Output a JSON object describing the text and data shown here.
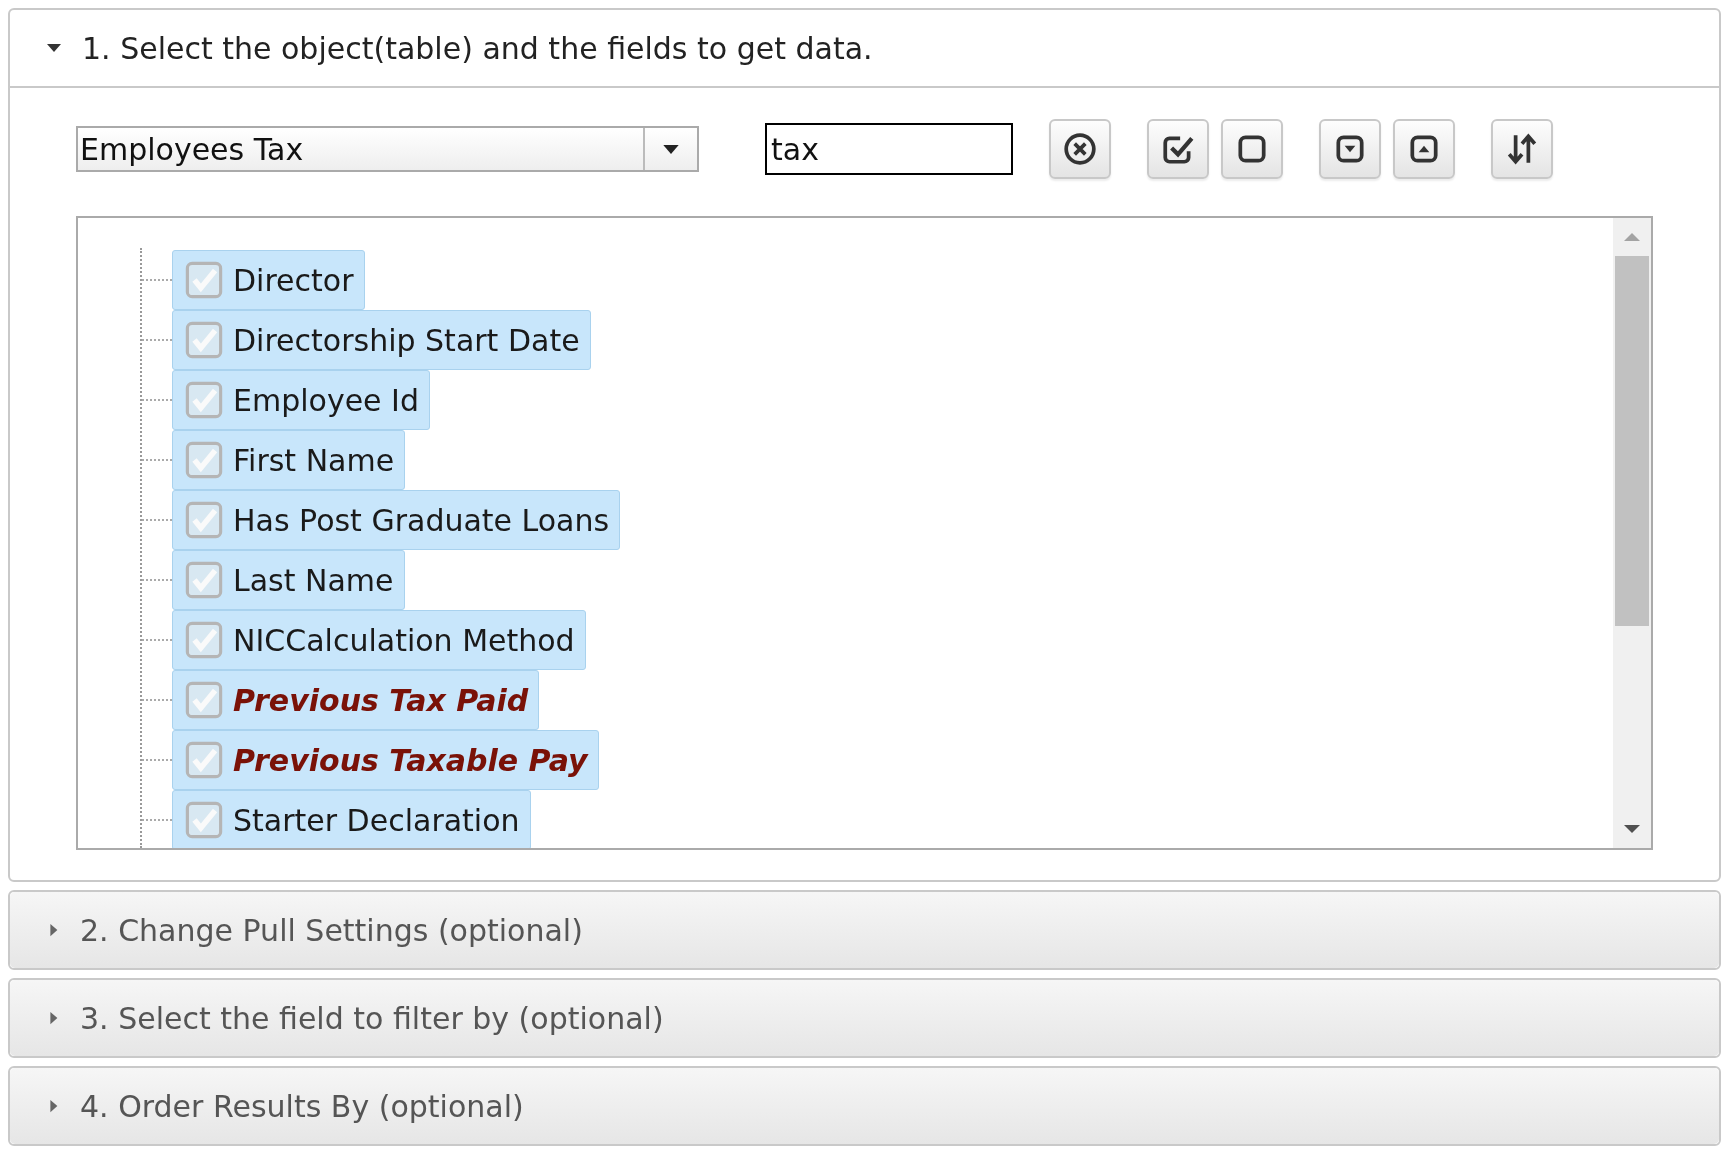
{
  "sections": [
    {
      "title": "1. Select the object(table) and the fields to get data.",
      "expanded": true
    },
    {
      "title": "2. Change Pull Settings (optional)",
      "expanded": false
    },
    {
      "title": "3. Select the field to filter by (optional)",
      "expanded": false
    },
    {
      "title": "4. Order Results By (optional)",
      "expanded": false
    }
  ],
  "object_select": {
    "value": "Employees Tax"
  },
  "search": {
    "value": "tax"
  },
  "toolbar": [
    [
      {
        "kind": "clear"
      }
    ],
    [
      {
        "kind": "check_all"
      },
      {
        "kind": "uncheck_all"
      }
    ],
    [
      {
        "kind": "expand"
      },
      {
        "kind": "collapse"
      }
    ],
    [
      {
        "kind": "sort"
      }
    ]
  ],
  "fields": [
    {
      "label": "Director",
      "checked": true,
      "highlighted": false
    },
    {
      "label": "Directorship Start Date",
      "checked": true,
      "highlighted": false
    },
    {
      "label": "Employee Id",
      "checked": true,
      "highlighted": false
    },
    {
      "label": "First Name",
      "checked": true,
      "highlighted": false
    },
    {
      "label": "Has Post Graduate Loans",
      "checked": true,
      "highlighted": false
    },
    {
      "label": "Last Name",
      "checked": true,
      "highlighted": false
    },
    {
      "label": "NICCalculation Method",
      "checked": true,
      "highlighted": false
    },
    {
      "label": "Previous Tax Paid",
      "checked": true,
      "highlighted": true
    },
    {
      "label": "Previous Taxable Pay",
      "checked": true,
      "highlighted": true
    },
    {
      "label": "Starter Declaration",
      "checked": true,
      "highlighted": false
    }
  ]
}
